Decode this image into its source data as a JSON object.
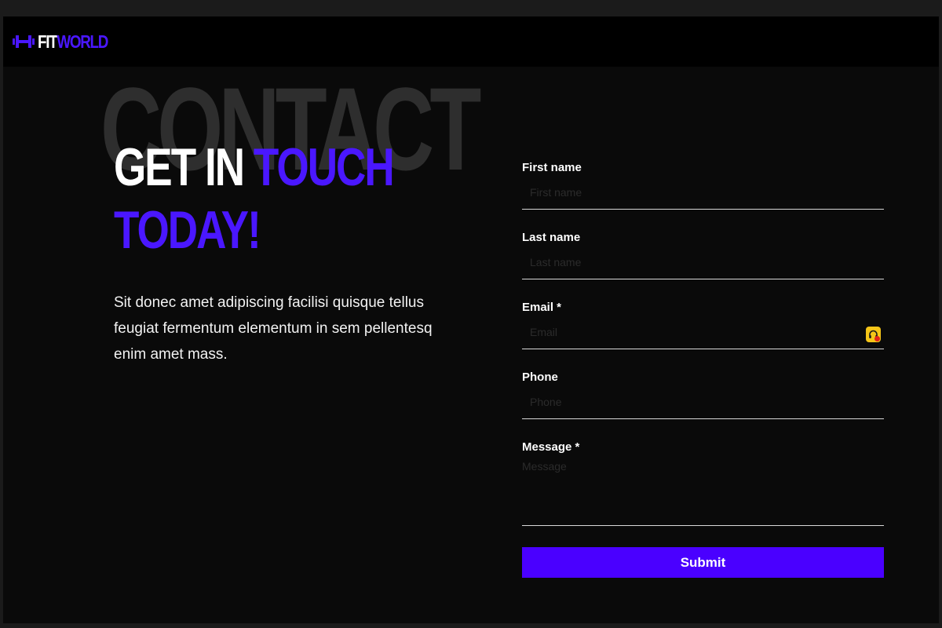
{
  "brand": {
    "name_part1": "FIT",
    "name_part2": "WORLD",
    "icon": "dumbbell-icon",
    "accent_color": "#4a17ff"
  },
  "hero": {
    "background_word": "CONTACT",
    "headline_part1": "GET IN ",
    "headline_part2": "TOUCH",
    "headline_part3": "TODAY!",
    "intro_lines": [
      "Sit donec amet adipiscing facilisi quisque tellus",
      "feugiat fermentum elementum in sem pellentesq",
      "enim amet mass."
    ]
  },
  "form": {
    "first_name": {
      "label": "First name",
      "placeholder": "First name",
      "value": ""
    },
    "last_name": {
      "label": "Last name",
      "placeholder": "Last name",
      "value": ""
    },
    "email": {
      "label": "Email *",
      "placeholder": "Email",
      "value": "",
      "autofill_icon": "password-manager-icon"
    },
    "phone": {
      "label": "Phone",
      "placeholder": "Phone",
      "value": ""
    },
    "message": {
      "label": "Message *",
      "placeholder": "Message",
      "value": ""
    },
    "submit_label": "Submit",
    "submit_color": "#4a00ff"
  }
}
